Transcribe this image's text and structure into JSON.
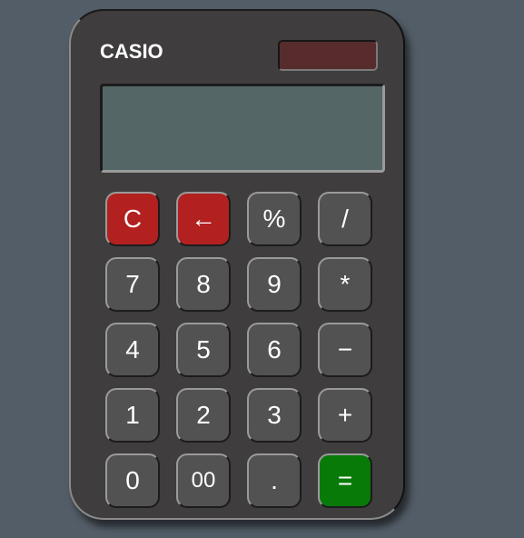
{
  "brand": "CASIO",
  "display": {
    "value": ""
  },
  "keys": [
    {
      "label": "C",
      "name": "clear-button",
      "style": "red"
    },
    {
      "label": "←",
      "name": "backspace-button",
      "style": "red"
    },
    {
      "label": "%",
      "name": "percent-button",
      "style": "normal"
    },
    {
      "label": "/",
      "name": "divide-button",
      "style": "normal"
    },
    {
      "label": "7",
      "name": "digit-7-button",
      "style": "normal"
    },
    {
      "label": "8",
      "name": "digit-8-button",
      "style": "normal"
    },
    {
      "label": "9",
      "name": "digit-9-button",
      "style": "normal"
    },
    {
      "label": "*",
      "name": "multiply-button",
      "style": "normal"
    },
    {
      "label": "4",
      "name": "digit-4-button",
      "style": "normal"
    },
    {
      "label": "5",
      "name": "digit-5-button",
      "style": "normal"
    },
    {
      "label": "6",
      "name": "digit-6-button",
      "style": "normal"
    },
    {
      "label": "−",
      "name": "subtract-button",
      "style": "normal"
    },
    {
      "label": "1",
      "name": "digit-1-button",
      "style": "normal"
    },
    {
      "label": "2",
      "name": "digit-2-button",
      "style": "normal"
    },
    {
      "label": "3",
      "name": "digit-3-button",
      "style": "normal"
    },
    {
      "label": "+",
      "name": "add-button",
      "style": "normal"
    },
    {
      "label": "0",
      "name": "digit-0-button",
      "style": "normal"
    },
    {
      "label": "00",
      "name": "double-zero-button",
      "style": "normal"
    },
    {
      "label": ".",
      "name": "decimal-point-button",
      "style": "normal"
    },
    {
      "label": "=",
      "name": "equals-button",
      "style": "green"
    }
  ],
  "colors": {
    "background": "#535d67",
    "body": "#3f3d3d",
    "key": "#525252",
    "clear_key": "#b32020",
    "equals_key": "#087a08",
    "display": "#546766",
    "solar_panel": "#582c2c"
  }
}
